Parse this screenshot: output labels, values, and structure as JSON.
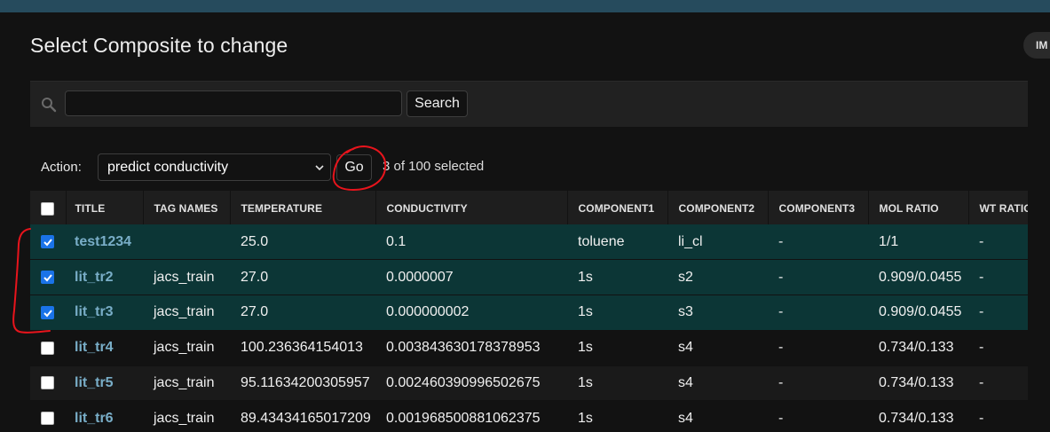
{
  "header": {
    "title": "Select Composite to change",
    "import_label": "IM"
  },
  "search": {
    "value": "",
    "placeholder": "",
    "button_label": "Search"
  },
  "actions": {
    "label": "Action:",
    "selected_action": "predict conductivity",
    "go_label": "Go",
    "selection_status": "3 of 100 selected"
  },
  "table": {
    "columns": [
      "TITLE",
      "TAG NAMES",
      "TEMPERATURE",
      "CONDUCTIVITY",
      "COMPONENT1",
      "COMPONENT2",
      "COMPONENT3",
      "MOL RATIO",
      "WT RATIO"
    ],
    "rows": [
      {
        "checked": true,
        "title": "test1234",
        "tag_names": "",
        "temperature": "25.0",
        "conductivity": "0.1",
        "component1": "toluene",
        "component2": "li_cl",
        "component3": "-",
        "mol_ratio": "1/1",
        "wt_ratio": "-"
      },
      {
        "checked": true,
        "title": "lit_tr2",
        "tag_names": "jacs_train",
        "temperature": "27.0",
        "conductivity": "0.0000007",
        "component1": "1s",
        "component2": "s2",
        "component3": "-",
        "mol_ratio": "0.909/0.0455",
        "wt_ratio": "-"
      },
      {
        "checked": true,
        "title": "lit_tr3",
        "tag_names": "jacs_train",
        "temperature": "27.0",
        "conductivity": "0.000000002",
        "component1": "1s",
        "component2": "s3",
        "component3": "-",
        "mol_ratio": "0.909/0.0455",
        "wt_ratio": "-"
      },
      {
        "checked": false,
        "title": "lit_tr4",
        "tag_names": "jacs_train",
        "temperature": "100.236364154013",
        "conductivity": "0.003843630178378953",
        "component1": "1s",
        "component2": "s4",
        "component3": "-",
        "mol_ratio": "0.734/0.133",
        "wt_ratio": "-"
      },
      {
        "checked": false,
        "title": "lit_tr5",
        "tag_names": "jacs_train",
        "temperature": "95.11634200305957",
        "conductivity": "0.002460390996502675",
        "component1": "1s",
        "component2": "s4",
        "component3": "-",
        "mol_ratio": "0.734/0.133",
        "wt_ratio": "-"
      },
      {
        "checked": false,
        "title": "lit_tr6",
        "tag_names": "jacs_train",
        "temperature": "89.43434165017209",
        "conductivity": "0.001968500881062375",
        "component1": "1s",
        "component2": "s4",
        "component3": "-",
        "mol_ratio": "0.734/0.133",
        "wt_ratio": "-"
      }
    ]
  },
  "colors": {
    "header_bar": "#264b5d",
    "selected_row": "#0c3636",
    "link": "#79aec8",
    "checkbox_checked": "#1a73e8",
    "annotation": "#e8141c"
  }
}
